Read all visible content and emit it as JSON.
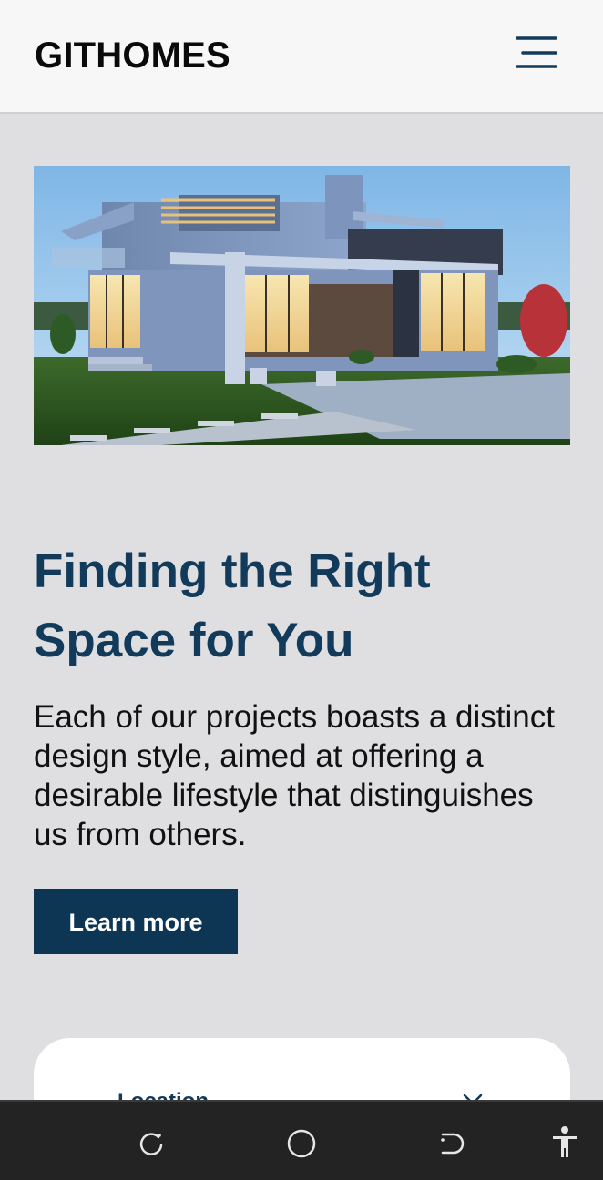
{
  "header": {
    "brand": "GITHOMES",
    "menu_icon": "hamburger-menu-icon"
  },
  "hero": {
    "image_alt": "modern-house-photo"
  },
  "content": {
    "headline": "Finding the Right Space for You",
    "description": "Each of our projects boasts a distinct design style, aimed at offering a desirable lifestyle that distinguishes us from others.",
    "cta_label": "Learn more"
  },
  "search": {
    "location_label": "Location",
    "chevron_icon": "chevron-down-icon"
  },
  "system_nav": {
    "icons": [
      "recent-apps-icon",
      "home-icon",
      "back-icon",
      "accessibility-icon"
    ]
  },
  "colors": {
    "brand_navy": "#0c3654",
    "headline_navy": "#123a5a",
    "page_bg": "#dfdfe1",
    "header_bg": "#f7f7f7",
    "navbar_bg": "#232323"
  }
}
